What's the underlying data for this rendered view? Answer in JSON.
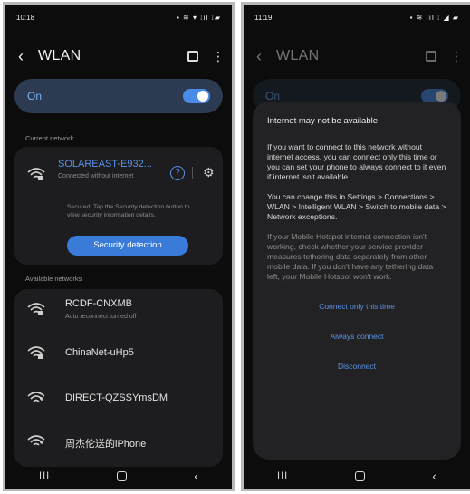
{
  "left": {
    "status": {
      "time": "10:18",
      "icons": "▪ ≋ ▾ ⁞ıl ⁞▰"
    },
    "appbar": {
      "back": "‹",
      "title": "WLAN",
      "more": "⋮"
    },
    "onrow": {
      "label": "On"
    },
    "current_section": "Current network",
    "current": {
      "name": "SOLAREAST-E932...",
      "status": "Connected without internet",
      "help": "?",
      "gear": "⚙",
      "info": "Secured. Tap the Security detection button to view security information details.",
      "button": "Security detection"
    },
    "available_section": "Available networks",
    "networks": [
      {
        "name": "RCDF-CNXMB",
        "sub": "Auto reconnect turned off"
      },
      {
        "name": "ChinaNet-uHp5",
        "sub": ""
      },
      {
        "name": "DIRECT-QZSSYmsDM",
        "sub": ""
      },
      {
        "name": "周杰伦送的iPhone",
        "sub": ""
      }
    ],
    "nav": {
      "recent": "III",
      "back": "‹"
    }
  },
  "right": {
    "status": {
      "time": "11:19",
      "icons": "▪ ≋ ⁞ıl ⁞ ◢ ▰"
    },
    "appbar": {
      "back": "‹",
      "title": "WLAN",
      "more": "⋮"
    },
    "onrow": {
      "label": "On"
    },
    "dialog": {
      "title": "Internet may not be available",
      "p1": "If you want to connect to this network without internet access, you can connect only this time or you can set your phone to always connect to it even if internet isn't available.",
      "p2": "You can change this in Settings > Connections > WLAN > Intelligent WLAN > Switch to mobile data > Network exceptions.",
      "p3": "If your Mobile Hotspot internet connection isn't working, check whether your service provider measures tethering data separately from other mobile data. If you don't have any tethering data left, your Mobile Hotspot won't work.",
      "actions": [
        "Connect only this time",
        "Always connect",
        "Disconnect"
      ]
    },
    "nav": {
      "recent": "III",
      "back": "‹"
    }
  }
}
